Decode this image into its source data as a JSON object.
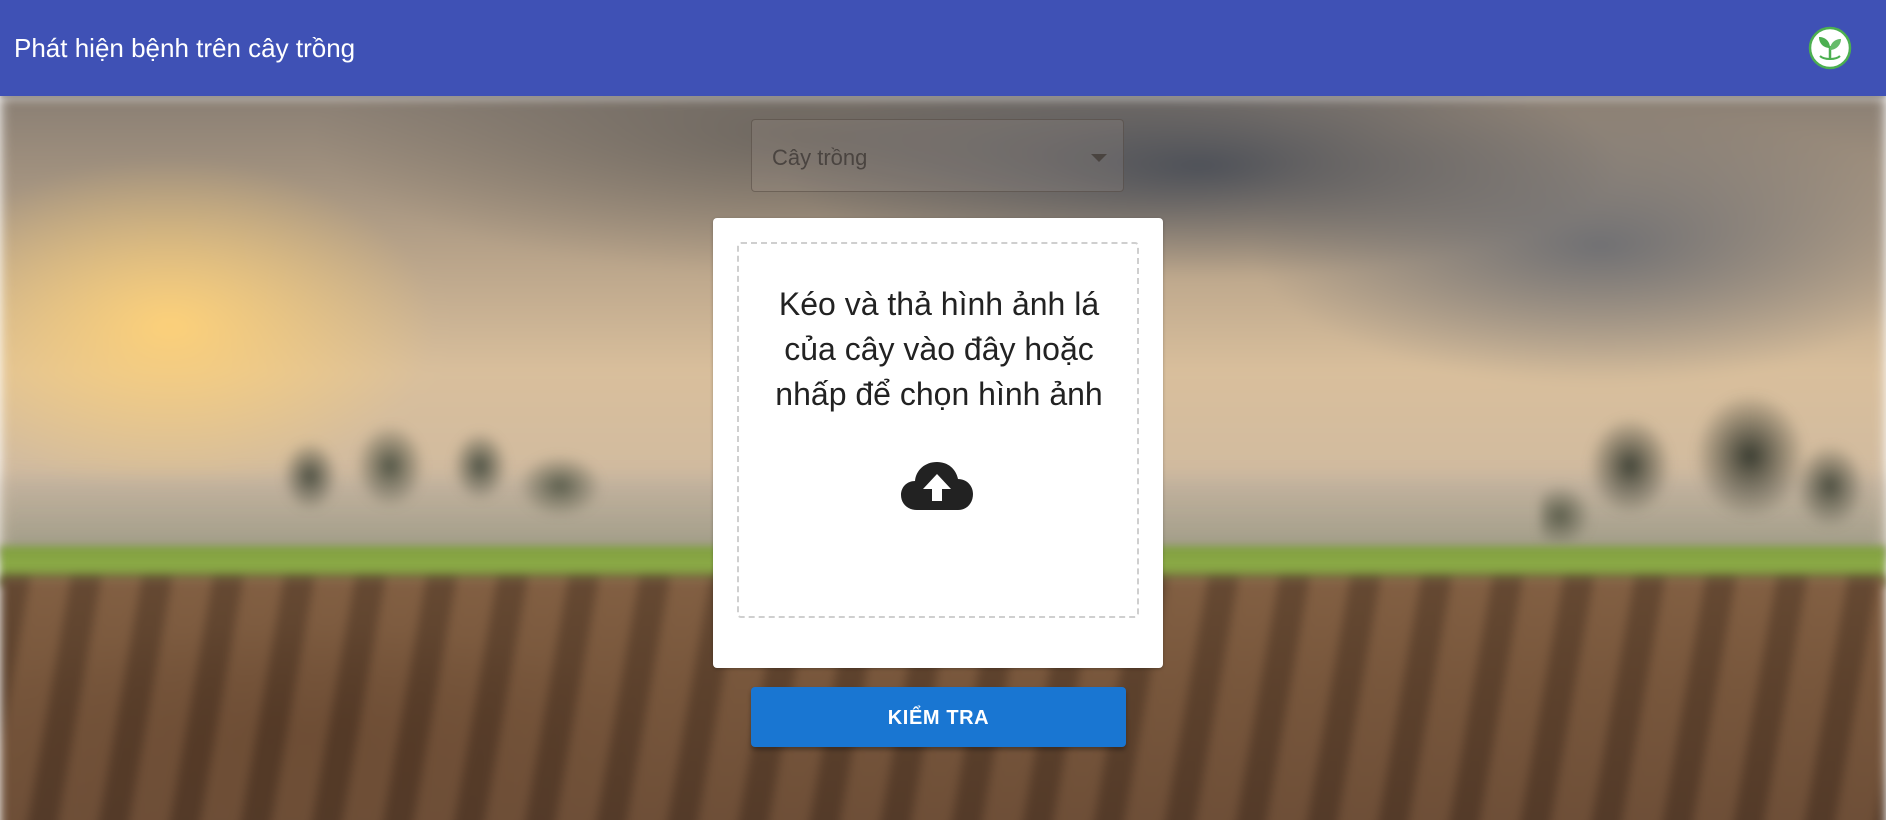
{
  "header": {
    "title": "Phát hiện bệnh trên cây trồng",
    "logo_icon": "plant-leaf-logo-icon",
    "color": "#3f51b5"
  },
  "crop_select": {
    "label": "Cây trồng",
    "arrow_icon": "caret-down-icon"
  },
  "upload": {
    "instruction": "Kéo và thả hình ảnh lá của cây vào đây hoặc nhấp để chọn hình ảnh",
    "icon": "cloud-upload-icon"
  },
  "actions": {
    "check_label": "KIỂM TRA",
    "check_color": "#1976d2"
  }
}
